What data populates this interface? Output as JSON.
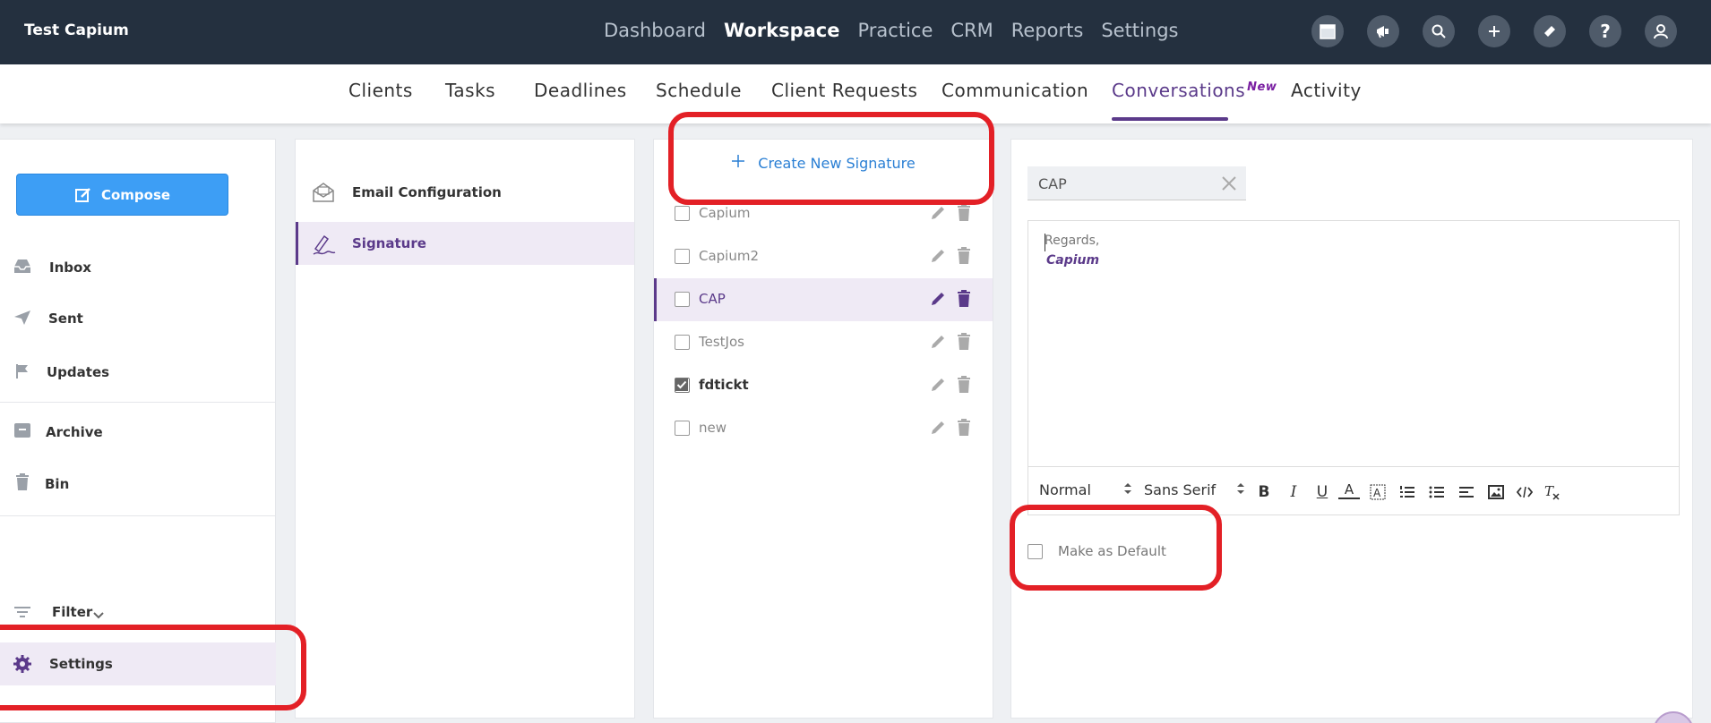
{
  "app": {
    "title": "Test Capium"
  },
  "main_nav": [
    "Dashboard",
    "Workspace",
    "Practice",
    "CRM",
    "Reports",
    "Settings"
  ],
  "main_nav_active": "Workspace",
  "top_icons": [
    "calendar-icon",
    "megaphone-icon",
    "search-icon",
    "plus-icon",
    "ticket-icon",
    "help-icon",
    "user-icon"
  ],
  "sub_nav": {
    "items": [
      "Clients",
      "Tasks",
      "Deadlines",
      "Schedule",
      "Client Requests",
      "Communication",
      "Conversations",
      "Activity"
    ],
    "active": "Conversations",
    "new_tag": "New"
  },
  "mail_sidebar": {
    "compose_label": "Compose",
    "items": [
      {
        "label": "Inbox",
        "icon": "inbox-icon"
      },
      {
        "label": "Sent",
        "icon": "send-icon"
      },
      {
        "label": "Updates",
        "icon": "flag-icon"
      },
      {
        "label": "Archive",
        "icon": "archive-icon"
      },
      {
        "label": "Bin",
        "icon": "trash-icon"
      }
    ],
    "filter_label": "Filter",
    "settings_label": "Settings"
  },
  "config_menu": {
    "items": [
      {
        "label": "Email Configuration",
        "icon": "envelope-icon"
      },
      {
        "label": "Signature",
        "icon": "signature-icon"
      }
    ],
    "active": "Signature"
  },
  "signatures": {
    "create_label": "Create New Signature",
    "list": [
      {
        "name": "Capium",
        "checked": false,
        "selected": false
      },
      {
        "name": "Capium2",
        "checked": false,
        "selected": false
      },
      {
        "name": "CAP",
        "checked": false,
        "selected": true
      },
      {
        "name": "TestJos",
        "checked": false,
        "selected": false
      },
      {
        "name": "fdtickt",
        "checked": true,
        "selected": false
      },
      {
        "name": "new",
        "checked": false,
        "selected": false
      }
    ]
  },
  "editor": {
    "name_value": "CAP",
    "body_line1": "Regards,",
    "body_line2": "Capium",
    "size_select": "Normal",
    "font_select": "Sans Serif",
    "toolbar_buttons": [
      "bold-icon",
      "italic-icon",
      "underline-icon",
      "text-color-icon",
      "highlight-icon",
      "ordered-list-icon",
      "bullet-list-icon",
      "align-icon",
      "image-icon",
      "code-icon",
      "clear-format-icon"
    ],
    "default_label": "Make as Default",
    "default_checked": false
  },
  "colors": {
    "topbar": "#24303f",
    "accent": "#5b3a8a",
    "compose_button": "#3d9ef5",
    "link_blue": "#2a7fd4",
    "annotation_red": "#e32026"
  }
}
